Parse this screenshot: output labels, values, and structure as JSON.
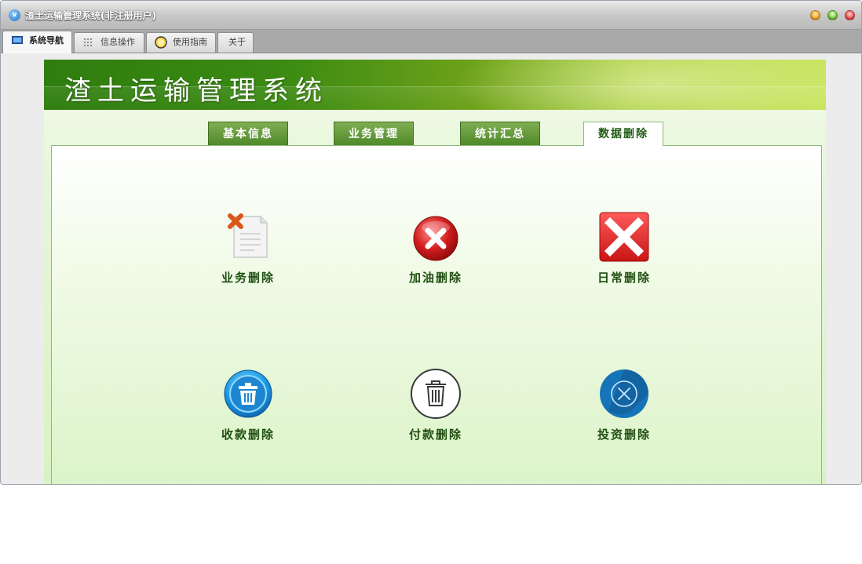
{
  "window": {
    "title": "渣土运输管理系统(非注册用户)",
    "app_icon_letter": "v"
  },
  "window_tabs": [
    {
      "label": "系统导航",
      "icon": "monitor-icon",
      "active": true
    },
    {
      "label": "信息操作",
      "icon": "grid-icon",
      "active": false
    },
    {
      "label": "使用指南",
      "icon": "help-circle-icon",
      "active": false
    },
    {
      "label": "关于",
      "icon": "",
      "active": false
    }
  ],
  "banner": {
    "title": "渣土运输管理系统"
  },
  "panel_tabs": [
    {
      "label": "基本信息",
      "active": false
    },
    {
      "label": "业务管理",
      "active": false
    },
    {
      "label": "统计汇总",
      "active": false
    },
    {
      "label": "数据删除",
      "active": true
    }
  ],
  "functions": [
    {
      "label": "业务删除",
      "icon": "document-delete-icon"
    },
    {
      "label": "加油删除",
      "icon": "red-circle-x-icon"
    },
    {
      "label": "日常删除",
      "icon": "red-square-x-icon"
    },
    {
      "label": "收款删除",
      "icon": "blue-trash-icon"
    },
    {
      "label": "付款删除",
      "icon": "outline-trash-icon"
    },
    {
      "label": "投资删除",
      "icon": "blue-circle-x-icon"
    }
  ],
  "colors": {
    "banner_dark": "#2f7d0f",
    "banner_light": "#c7e45c",
    "tab_green": "#5b9330",
    "label_green": "#1f4f10"
  }
}
